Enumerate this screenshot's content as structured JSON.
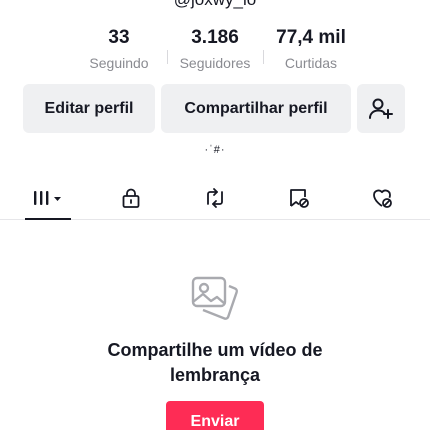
{
  "profile": {
    "username": "@joxwy_lo"
  },
  "stats": [
    {
      "value": "33",
      "label": "Seguindo"
    },
    {
      "value": "3.186",
      "label": "Seguidores"
    },
    {
      "value": "77,4 mil",
      "label": "Curtidas"
    }
  ],
  "actions": {
    "edit_label": "Editar perfil",
    "share_label": "Compartilhar perfil",
    "add_friend_icon": "person-add-icon"
  },
  "bio": "·ˈ#·",
  "tabs": [
    {
      "name": "videos-grid",
      "icon": "grid-icon",
      "active": true
    },
    {
      "name": "private",
      "icon": "lock-icon",
      "active": false
    },
    {
      "name": "reposts",
      "icon": "repost-icon",
      "active": false
    },
    {
      "name": "favorites",
      "icon": "bookmark-icon",
      "active": false
    },
    {
      "name": "liked",
      "icon": "heart-hidden-icon",
      "active": false
    }
  ],
  "empty_state": {
    "icon": "photos-icon",
    "message_line1": "Compartilhe um vídeo de",
    "message_line2": "lembrança",
    "button_label": "Enviar"
  },
  "colors": {
    "primary": "#fe2c55",
    "button_bg": "#eff0f2",
    "text": "#161823",
    "muted": "#8a8b91"
  }
}
